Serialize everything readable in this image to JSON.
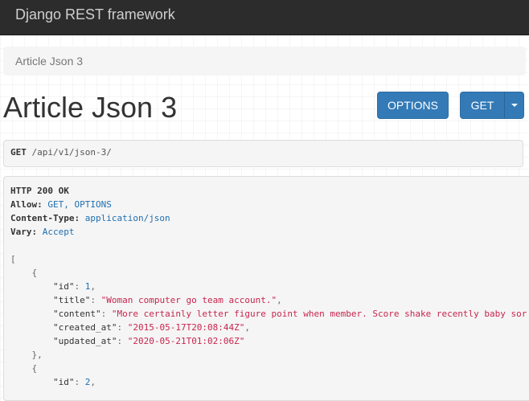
{
  "navbar": {
    "brand": "Django REST framework"
  },
  "breadcrumb": {
    "current": "Article Json 3"
  },
  "page": {
    "title": "Article Json 3"
  },
  "buttons": {
    "options": "OPTIONS",
    "get": "GET"
  },
  "request": {
    "method": "GET",
    "url": "/api/v1/json-3/"
  },
  "response": {
    "status": "HTTP 200 OK",
    "headers": [
      {
        "key": "Allow:",
        "value": "GET, OPTIONS"
      },
      {
        "key": "Content-Type:",
        "value": "application/json"
      },
      {
        "key": "Vary:",
        "value": "Accept"
      }
    ],
    "open_bracket": "[",
    "items": [
      {
        "id": "1",
        "title": "\"Woman computer go team account.\"",
        "content": "\"More certainly letter figure point when member. Score shake recently baby sor",
        "created_at": "\"2015-05-17T20:08:44Z\"",
        "updated_at": "\"2020-05-21T01:02:06Z\""
      },
      {
        "id": "2"
      }
    ],
    "keys": {
      "id": "\"id\"",
      "title": "\"title\"",
      "content": "\"content\"",
      "created_at": "\"created_at\"",
      "updated_at": "\"updated_at\""
    }
  }
}
